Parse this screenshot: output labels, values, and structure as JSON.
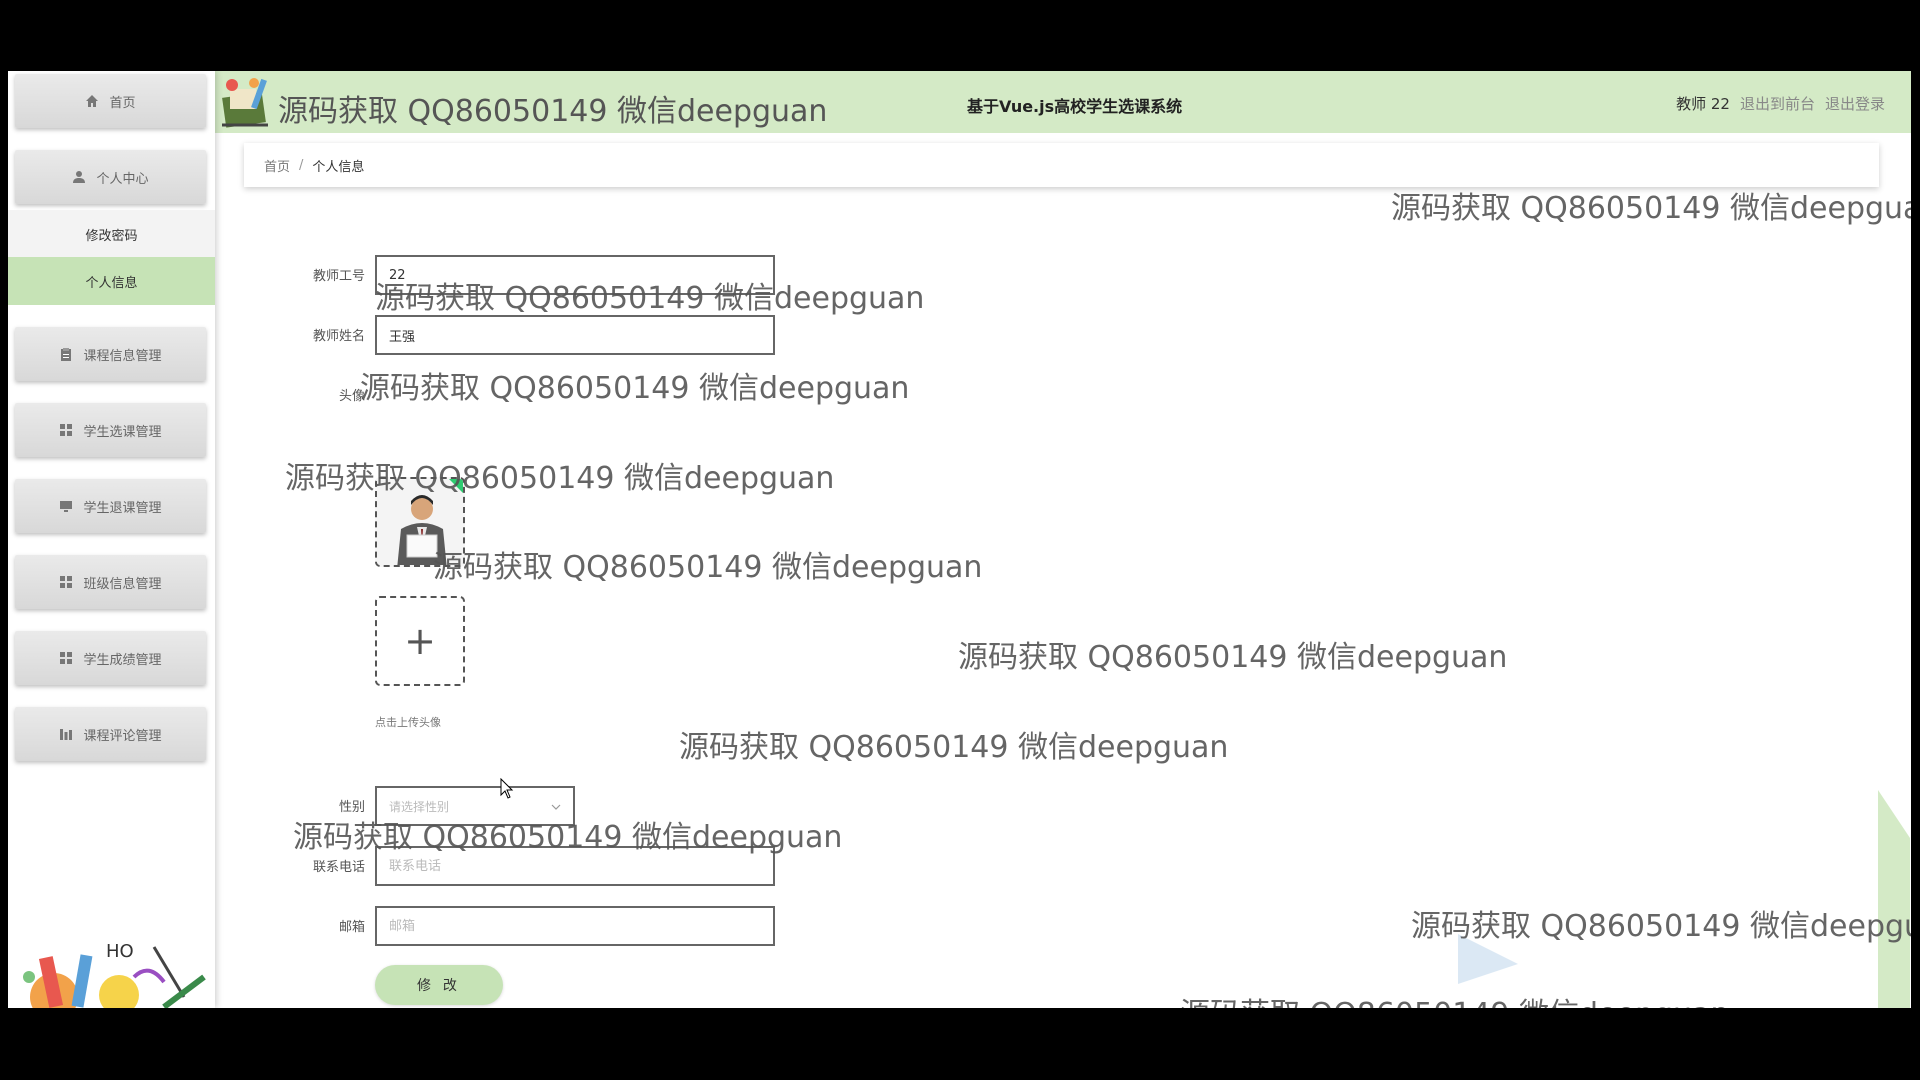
{
  "header": {
    "watermark": "源码获取 QQ86050149 微信deepguan",
    "title": "基于Vue.js高校学生选课系统",
    "user_label": "教师 22",
    "exit_front_label": "退出到前台",
    "logout_label": "退出登录"
  },
  "sidebar": {
    "home_label": "首页",
    "personal_center_label": "个人中心",
    "change_password_label": "修改密码",
    "personal_info_label": "个人信息",
    "items": [
      {
        "label": "课程信息管理",
        "icon": "clipboard-icon"
      },
      {
        "label": "学生选课管理",
        "icon": "grid-icon"
      },
      {
        "label": "学生退课管理",
        "icon": "monitor-icon"
      },
      {
        "label": "班级信息管理",
        "icon": "grid-icon"
      },
      {
        "label": "学生成绩管理",
        "icon": "grid-icon"
      },
      {
        "label": "课程评论管理",
        "icon": "chart-icon"
      }
    ]
  },
  "breadcrumb": {
    "home": "首页",
    "separator": "/",
    "current": "个人信息"
  },
  "form": {
    "teacher_id": {
      "label": "教师工号",
      "value": "22"
    },
    "teacher_name": {
      "label": "教师姓名",
      "value": "王强"
    },
    "avatar": {
      "label": "头像",
      "upload_tip": "点击上传头像"
    },
    "gender": {
      "label": "性别",
      "placeholder": "请选择性别"
    },
    "phone": {
      "label": "联系电话",
      "placeholder": "联系电话"
    },
    "email": {
      "label": "邮箱",
      "placeholder": "邮箱"
    },
    "submit_label": "修 改"
  },
  "watermark_text": "源码获取 QQ86050149 微信deepguan",
  "colors": {
    "accent": "#c6e3b6",
    "header_bg": "#d4eac6"
  }
}
